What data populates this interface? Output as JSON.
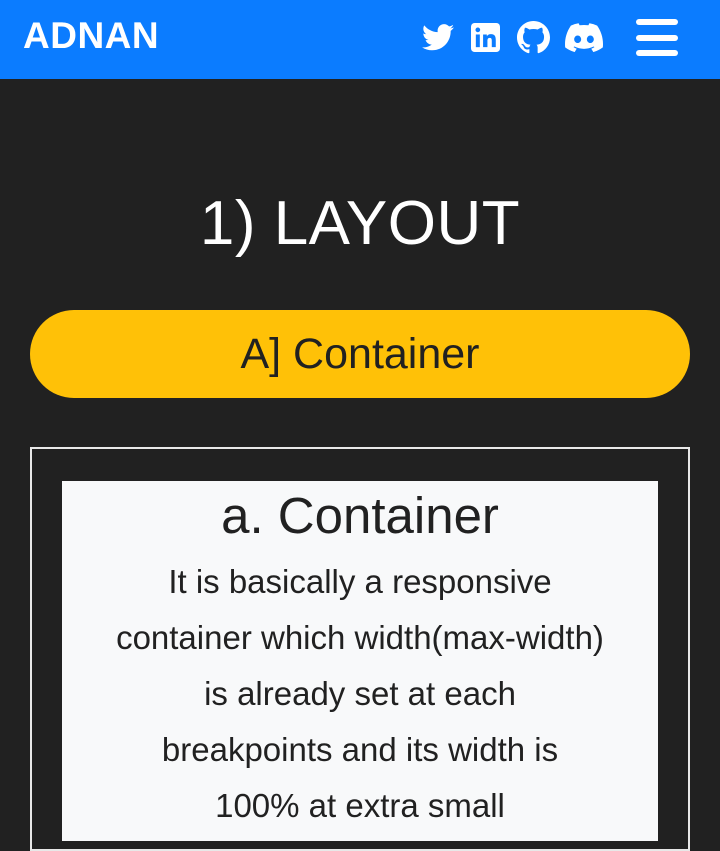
{
  "navbar": {
    "brand": "ADNAN",
    "icons": [
      "twitter-icon",
      "linkedin-icon",
      "github-icon",
      "discord-icon",
      "hamburger-menu-icon"
    ],
    "background": "#0b7cff"
  },
  "main": {
    "section_title": "1) LAYOUT",
    "subsection_pill": "A] Container",
    "pill_color": "#ffc107",
    "card": {
      "title": "a. Container",
      "text": "It is basically a responsive container which width(max-width) is already set at each breakpoints and its width is 100% at extra small"
    }
  }
}
